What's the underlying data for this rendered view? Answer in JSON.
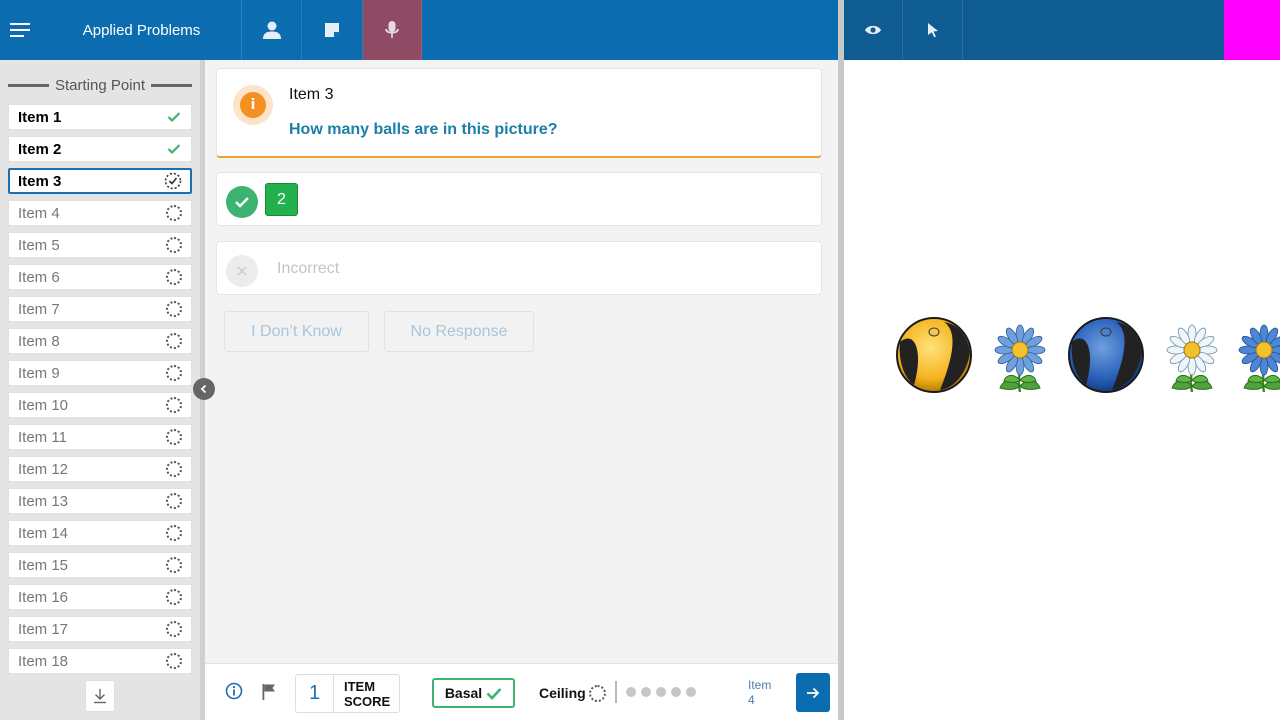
{
  "header": {
    "title": "Applied Problems"
  },
  "sidebar": {
    "heading": "Starting Point",
    "items": [
      {
        "label": "Item 1",
        "status": "complete"
      },
      {
        "label": "Item 2",
        "status": "complete"
      },
      {
        "label": "Item 3",
        "status": "current"
      },
      {
        "label": "Item 4",
        "status": "pending"
      },
      {
        "label": "Item 5",
        "status": "pending"
      },
      {
        "label": "Item 6",
        "status": "pending"
      },
      {
        "label": "Item 7",
        "status": "pending"
      },
      {
        "label": "Item 8",
        "status": "pending"
      },
      {
        "label": "Item 9",
        "status": "pending"
      },
      {
        "label": "Item 10",
        "status": "pending"
      },
      {
        "label": "Item 11",
        "status": "pending"
      },
      {
        "label": "Item 12",
        "status": "pending"
      },
      {
        "label": "Item 13",
        "status": "pending"
      },
      {
        "label": "Item 14",
        "status": "pending"
      },
      {
        "label": "Item 15",
        "status": "pending"
      },
      {
        "label": "Item 16",
        "status": "pending"
      },
      {
        "label": "Item 17",
        "status": "pending"
      },
      {
        "label": "Item 18",
        "status": "pending"
      }
    ]
  },
  "question": {
    "item_label": "Item 3",
    "prompt": "How many balls are in this picture?"
  },
  "correct": {
    "answer": "2"
  },
  "incorrect": {
    "label": "Incorrect"
  },
  "responses": {
    "dont_know": "I Don’t Know",
    "no_response": "No Response"
  },
  "footer": {
    "item_score": "1",
    "item_score_label_line1": "ITEM",
    "item_score_label_line2": "SCORE",
    "basal_label": "Basal",
    "ceiling_label": "Ceiling",
    "next_label_line1": "Item",
    "next_label_line2": "4"
  },
  "colors": {
    "header_blue": "#0b6db0",
    "right_header": "#0f5c93",
    "mic_active": "#8e4b63",
    "correct_green": "#3cb371",
    "question_teal": "#1b7fa8",
    "info_orange": "#f39120",
    "magenta_block": "#ff00ff"
  },
  "stimulus": {
    "sequence": [
      "yellow-beach-ball",
      "blue-daisy",
      "blue-beach-ball",
      "white-daisy",
      "blue-daisy"
    ]
  }
}
